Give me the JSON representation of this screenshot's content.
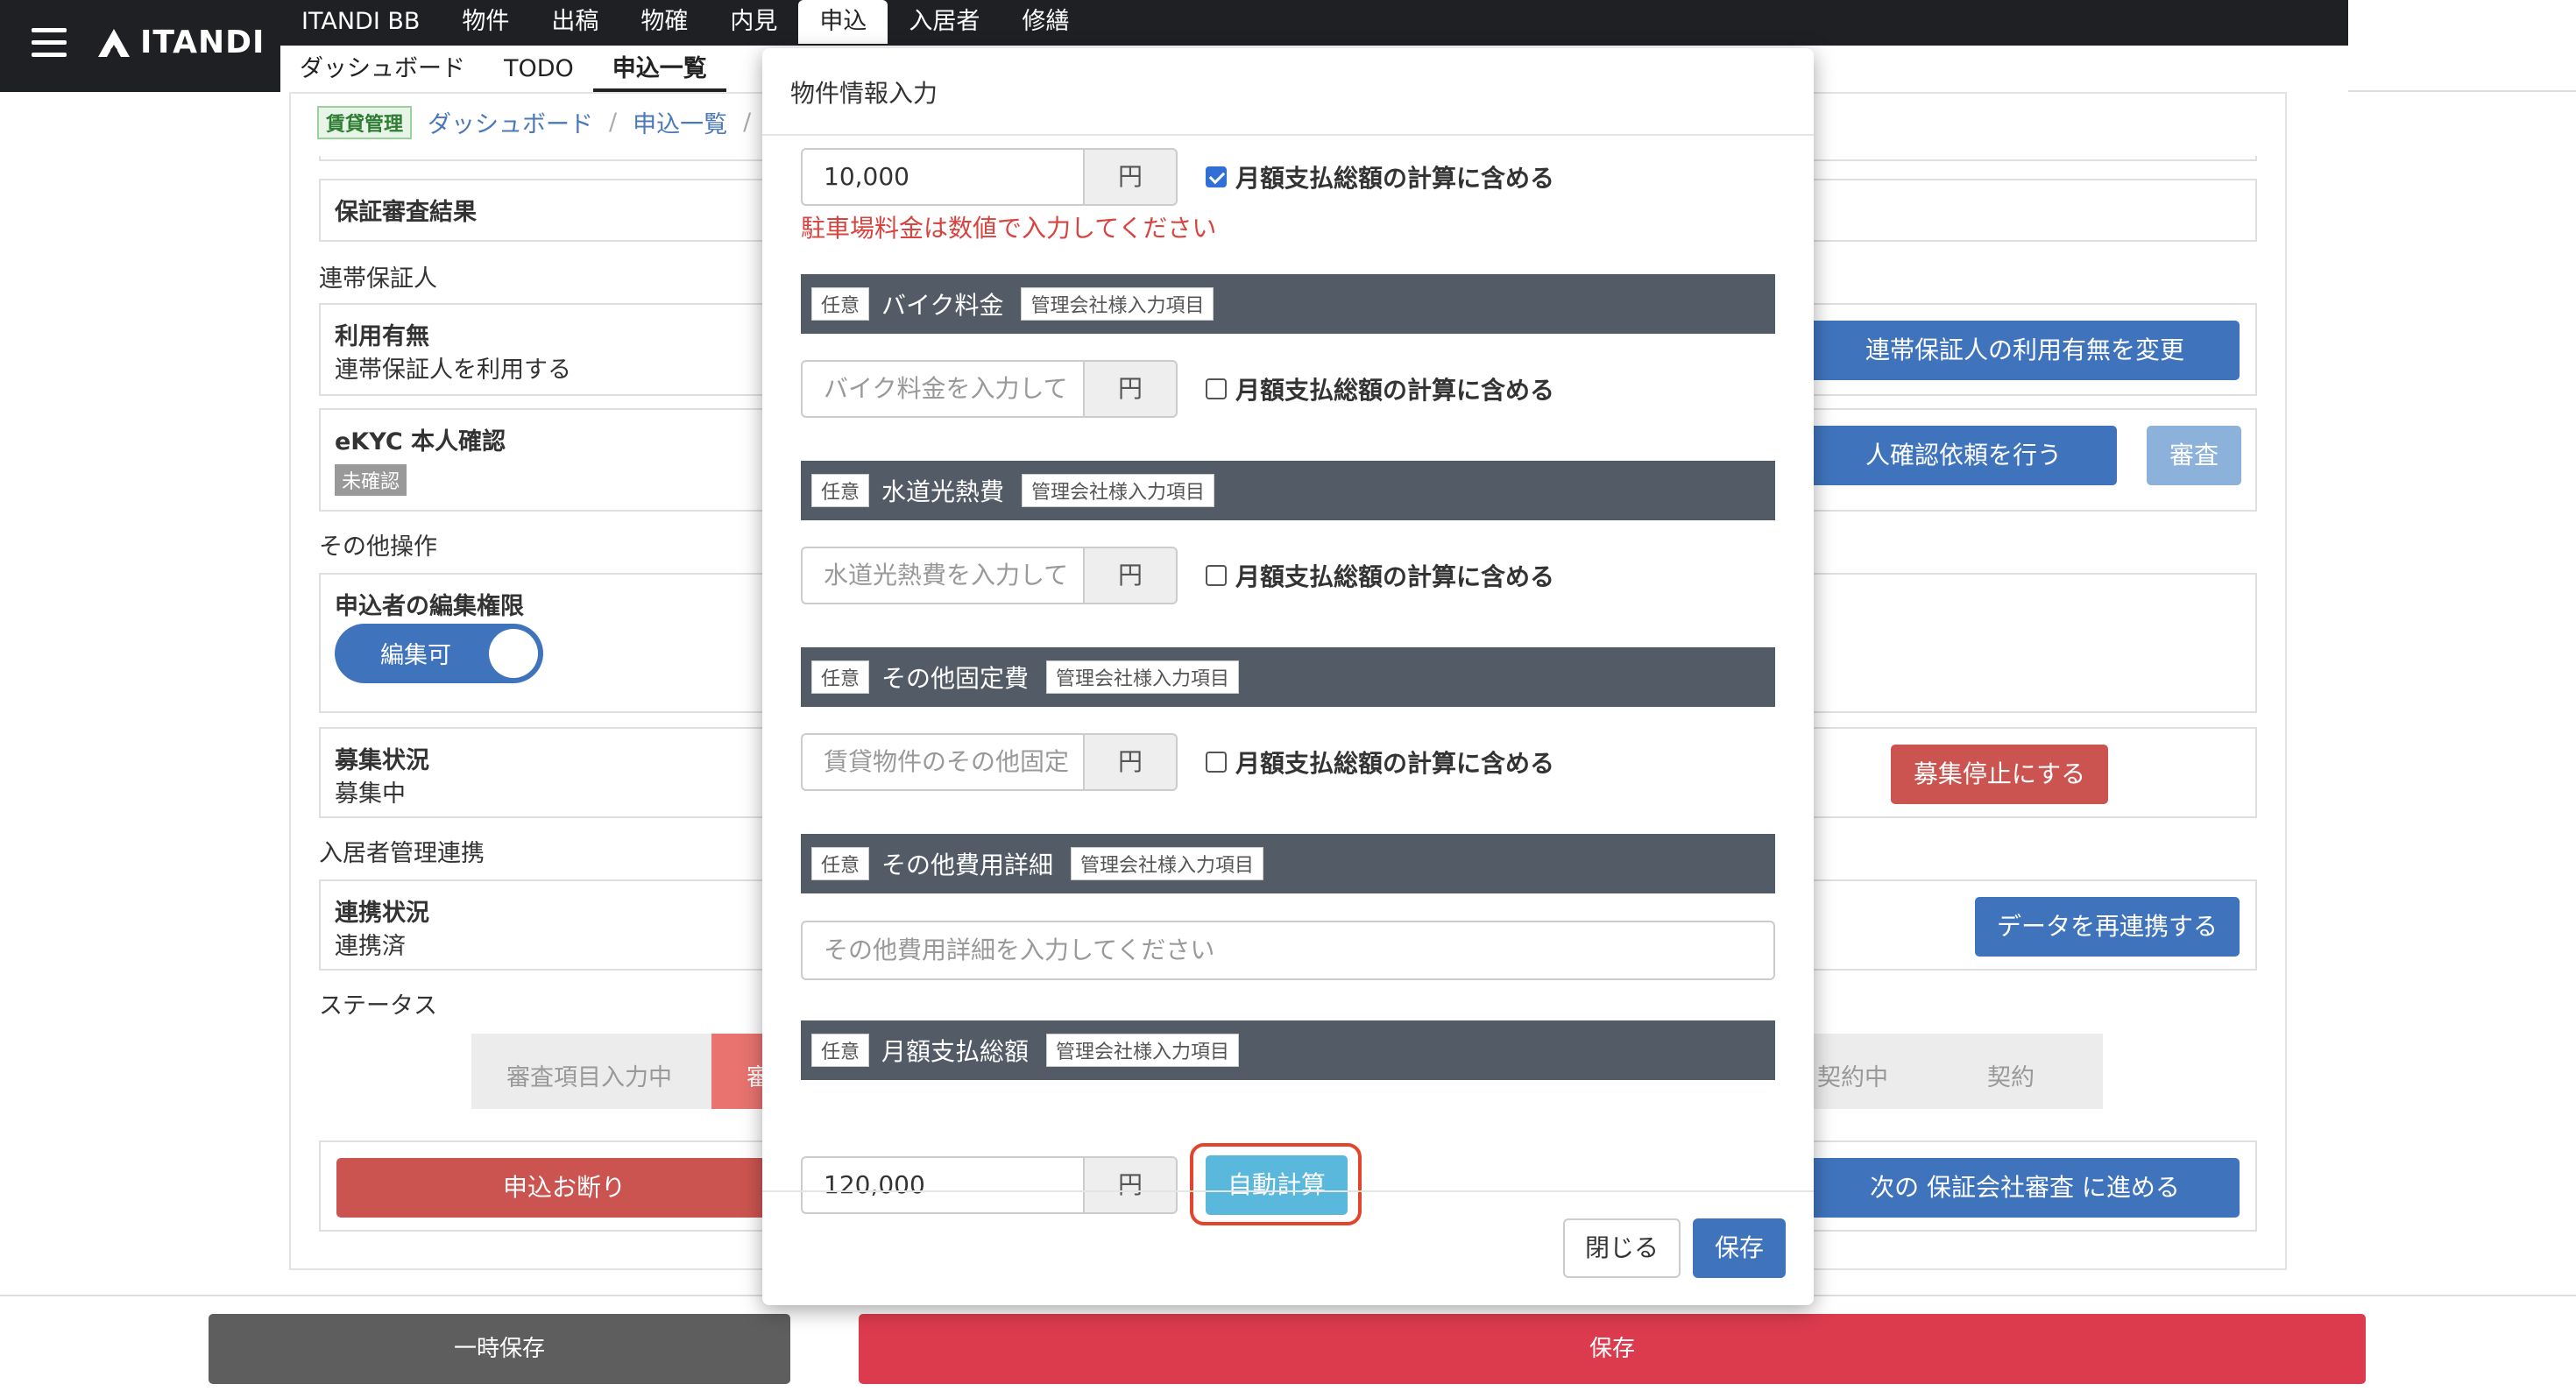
{
  "header": {
    "logo_text": "ITANDI",
    "nav_main": [
      "ITANDI BB",
      "物件",
      "出稿",
      "物確",
      "内見",
      "申込",
      "入居者",
      "修繕"
    ],
    "nav_sub": [
      "ダッシュボード",
      "TODO",
      "申込一覧"
    ]
  },
  "breadcrumb": {
    "badge": "賃貸管理",
    "items": [
      "ダッシュボード",
      "申込一覧"
    ],
    "sep": "/"
  },
  "page": {
    "guarantee_result_label": "保証審査結果",
    "joint_guarantor_section": "連帯保証人",
    "usage_label": "利用有無",
    "usage_value": "連帯保証人を利用する",
    "change_usage_button": "連帯保証人の利用有無を変更",
    "ekyc_label": "eKYC 本人確認",
    "ekyc_status": "未確認",
    "ekyc_request_button": "人確認依頼を行う",
    "review_button": "審査",
    "other_ops_section": "その他操作",
    "edit_perm_label": "申込者の編集権限",
    "edit_toggle_label": "編集可",
    "recruit_label": "募集状況",
    "recruit_value": "募集中",
    "stop_recruit_button": "募集停止にする",
    "tenant_link_section": "入居者管理連携",
    "link_status_label": "連携状況",
    "link_status_value": "連携済",
    "relink_button": "データを再連携する",
    "status_section": "ステータス",
    "steps": [
      "審査項目入力中",
      "審",
      "契約中",
      "契約"
    ],
    "decline_button": "申込お断り",
    "next_button": "次の 保証会社審査 に進める"
  },
  "footer": {
    "temp_save": "一時保存",
    "save": "保存"
  },
  "modal": {
    "title": "物件情報入力",
    "parking": {
      "value": "10,000",
      "unit": "円",
      "include_label": "月額支払総額の計算に含める",
      "include_checked": true,
      "error": "駐車場料金は数値で入力してください"
    },
    "fields": [
      {
        "optional": "任意",
        "name": "バイク料金",
        "mgmt": "管理会社様入力項目",
        "placeholder": "バイク料金を入力して",
        "unit": "円",
        "include_label": "月額支払総額の計算に含める"
      },
      {
        "optional": "任意",
        "name": "水道光熱費",
        "mgmt": "管理会社様入力項目",
        "placeholder": "水道光熱費を入力して",
        "unit": "円",
        "include_label": "月額支払総額の計算に含める"
      },
      {
        "optional": "任意",
        "name": "その他固定費",
        "mgmt": "管理会社様入力項目",
        "placeholder": "賃貸物件のその他固定",
        "unit": "円",
        "include_label": "月額支払総額の計算に含める"
      }
    ],
    "other_detail": {
      "optional": "任意",
      "name": "その他費用詳細",
      "mgmt": "管理会社様入力項目",
      "placeholder": "その他費用詳細を入力してください"
    },
    "monthly_total": {
      "optional": "任意",
      "name": "月額支払総額",
      "mgmt": "管理会社様入力項目",
      "value": "120,000",
      "unit": "円",
      "auto_calc": "自動計算"
    },
    "close_button": "閉じる",
    "save_button": "保存"
  }
}
